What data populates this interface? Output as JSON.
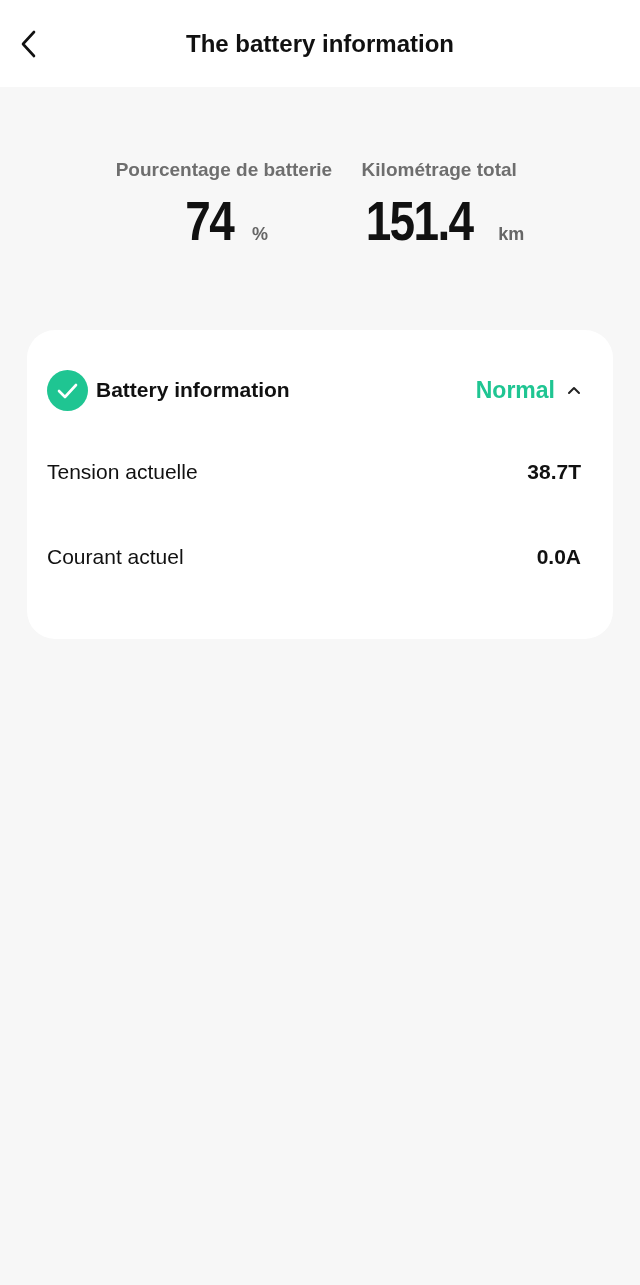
{
  "header": {
    "title": "The battery information"
  },
  "stats": [
    {
      "label": "Pourcentage de batterie",
      "value": "74",
      "unit": "%"
    },
    {
      "label": "Kilométrage total",
      "value": "151.4",
      "unit": "km"
    }
  ],
  "card": {
    "title": "Battery information",
    "status": "Normal",
    "expanded": true,
    "rows": [
      {
        "label": "Tension actuelle",
        "value": "38.7T"
      },
      {
        "label": "Courant actuel",
        "value": "0.0A"
      }
    ]
  }
}
